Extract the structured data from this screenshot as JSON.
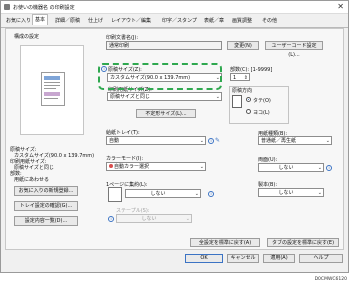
{
  "window": {
    "title": "お使いの機器名 の印刷設定",
    "close_glyph": "✕"
  },
  "tabs": [
    "お気に入り",
    "基本",
    "詳細／原稿",
    "仕上げ",
    "レイアウト／編集",
    "印字／スタンプ",
    "表紙／章",
    "画質調整",
    "その他"
  ],
  "left": {
    "preview_label": "構成の設定",
    "summary": {
      "line1": "原稿サイズ:",
      "line2": "カスタムサイズ(90.0 x 139.7mm)",
      "line3": "印刷用紙サイズ:",
      "line4": "原稿サイズと同じ",
      "line5": "部数:",
      "line6": "用紙にあわせる"
    },
    "buttons": [
      "お気に入りの新規登録...",
      "トレイ設定の確認(G)...",
      "設定内容一覧(D)..."
    ]
  },
  "form": {
    "document_name_label": "印刷文書名(J):",
    "document_name_value": "通常印刷",
    "change_button": "変更(N)",
    "user_code_button": "ユーザーコード設定(L)...",
    "original_size_label": "原稿サイズ(Z):",
    "original_size_value": "カスタムサイズ(90.0 x 139.7mm)",
    "paper_size_label": "印刷用紙サイズ(Z):",
    "paper_size_value": "原稿サイズと同じ",
    "custom_size_button": "不定形サイズ(L)...",
    "copies_label": "部数(C): [1-9999]",
    "copies_value": "1",
    "orientation_label": "原稿方向",
    "orientation_portrait": "タテ(O)",
    "orientation_landscape": "ヨコ(L)",
    "tray_label": "給紙トレイ(T):",
    "tray_value": "自動",
    "paper_type_label": "用紙種類(B):",
    "paper_type_value": "普通紙／再生紙",
    "color_label": "カラーモード(I):",
    "color_value": "自動カラー選択",
    "duplex_label": "両面(U):",
    "duplex_value": "しない",
    "layout_label": "1ページに集約(L):",
    "layout_value": "しない",
    "staple_label": "製本(B):",
    "staple_value": "しない",
    "staple_sub_label": "ステープル(S):",
    "staple_sub_value": "しない",
    "reset_basic_button": "全設定を標準に戻す(A)",
    "reset_tab_button": "タブの設定を標準に戻す(E)"
  },
  "footer": {
    "ok": "OK",
    "cancel": "キャンセル",
    "apply": "適用(A)",
    "help": "ヘルプ"
  },
  "caption": "D0CMWC6120"
}
